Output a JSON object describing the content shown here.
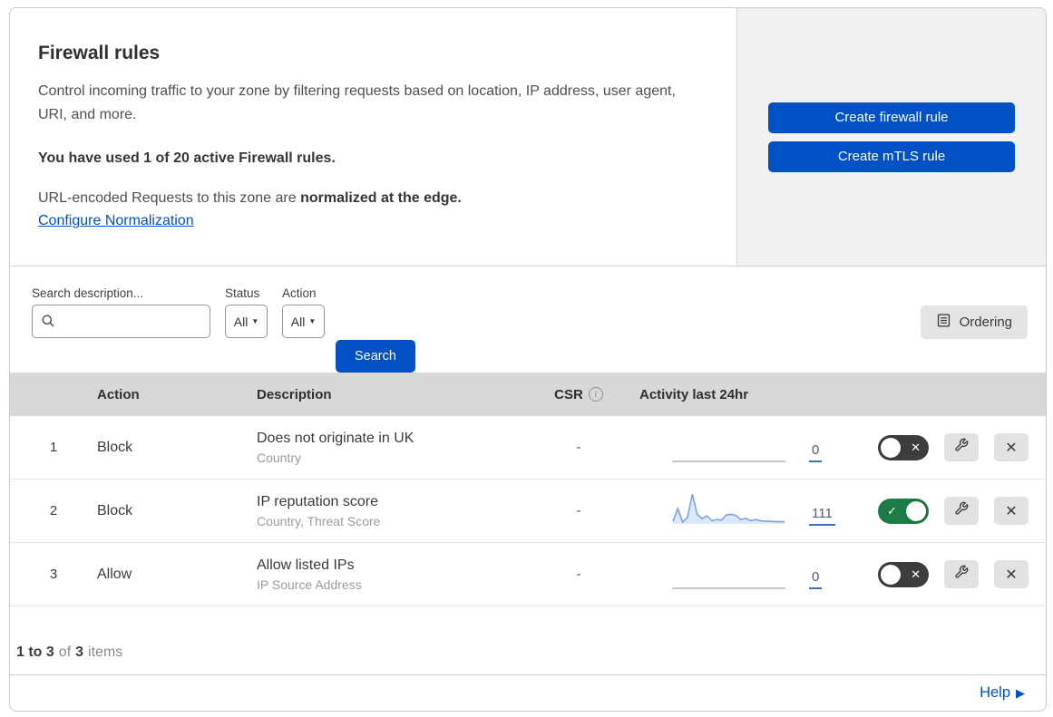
{
  "colors": {
    "primary_blue": "#0051c3",
    "toggle_on_green": "#1e7b43",
    "toggle_off_dark": "#3d3d3d",
    "sparkline_blue": "#78a3e8",
    "panel_gray": "#f1f1f2",
    "table_header_gray": "#d8d8d8"
  },
  "header": {
    "title": "Firewall rules",
    "description": "Control incoming traffic to your zone by filtering requests based on location, IP address, user agent, URI, and more.",
    "usage_note": "You have used 1 of 20 active Firewall rules.",
    "normalization_text": "URL-encoded Requests to this zone are ",
    "normalization_bold": "normalized at the edge.",
    "normalization_link": "Configure Normalization",
    "create_firewall_button": "Create firewall rule",
    "create_mtls_button": "Create mTLS rule"
  },
  "filters": {
    "search_label": "Search description...",
    "status_label": "Status",
    "status_value": "All",
    "action_label": "Action",
    "action_value": "All",
    "search_button": "Search",
    "ordering_button": "Ordering"
  },
  "table": {
    "columns": {
      "action": "Action",
      "description": "Description",
      "csr": "CSR",
      "activity": "Activity last 24hr"
    },
    "rows": [
      {
        "number": "1",
        "action": "Block",
        "description": "Does not originate in UK",
        "criteria": "Country",
        "csr": "-",
        "activity_count": "0",
        "enabled": false
      },
      {
        "number": "2",
        "action": "Block",
        "description": "IP reputation score",
        "criteria": "Country, Threat Score",
        "csr": "-",
        "activity_count": "111",
        "enabled": true,
        "sparkline_values": [
          5,
          50,
          3,
          20,
          100,
          30,
          15,
          25,
          8,
          12,
          10,
          28,
          30,
          26,
          12,
          16,
          8,
          12,
          8,
          6,
          6,
          5,
          5,
          4
        ]
      },
      {
        "number": "3",
        "action": "Allow",
        "description": "Allow listed IPs",
        "criteria": "IP Source Address",
        "csr": "-",
        "activity_count": "0",
        "enabled": false
      }
    ]
  },
  "footer": {
    "range_bold": "1 to 3",
    "of_text": "of",
    "total_bold": "3",
    "items_text": "items"
  },
  "help": {
    "label": "Help"
  },
  "icons": {
    "check": "✓",
    "cross": "✕",
    "close": "✕",
    "dropdown_arrow": "▼",
    "help_arrow": "▶",
    "info": "i"
  }
}
